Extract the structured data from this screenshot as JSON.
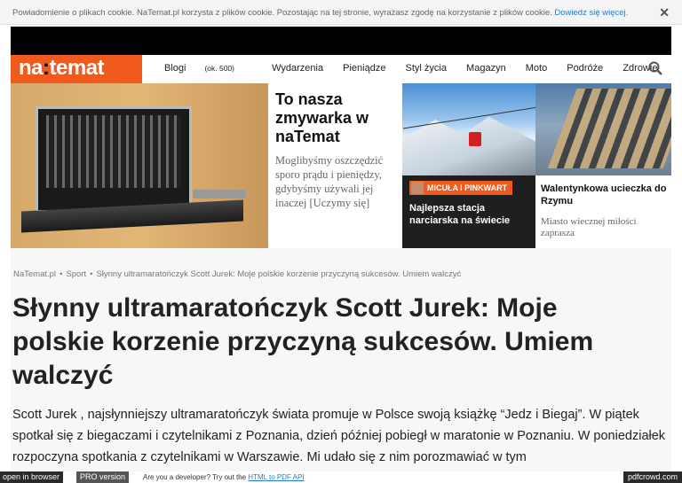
{
  "cookie": {
    "text": "Powiadomienie o plikach cookie. NaTemat.pl korzysta z plików cookie. Pozostając na tej stronie, wyrażasz zgodę na korzystanie z plików cookie. ",
    "link": "Dowiedz się więcej.",
    "close": "✕"
  },
  "nav": {
    "logo_a": "na",
    "logo_sep": ":",
    "logo_b": "temat",
    "items": [
      {
        "label": "Blogi",
        "extra": "(ok. 500)"
      },
      {
        "label": "Wydarzenia"
      },
      {
        "label": "Pieniądze"
      },
      {
        "label": "Styl życia"
      },
      {
        "label": "Magazyn"
      },
      {
        "label": "Moto"
      },
      {
        "label": "Podróże"
      },
      {
        "label": "Zdrowie"
      }
    ]
  },
  "hero": {
    "main_title": "To nasza zmywarka w naTemat",
    "main_text": "Moglibyśmy oszczędzić sporo prądu i pieniędzy, gdybyśmy używali jej inaczej [Uczymy się]",
    "ski_author": "MICUŁA I PINKWART",
    "ski_title": "Najlepsza stacja narciarska na świecie",
    "rome_title": "Walentynkowa ucieczka do Rzymu",
    "rome_text": "Miasto wiecznej miłości zaprasza"
  },
  "article": {
    "breadcrumbs": [
      "NaTemat.pl",
      "Sport",
      "Słynny ultramaratończyk Scott Jurek: Moje polskie korzenie przyczyną sukcesów. Umiem walczyć"
    ],
    "separator": "•",
    "title": "Słynny ultramaratończyk Scott Jurek: Moje polskie korzenie przyczyną sukcesów. Umiem walczyć",
    "lead": "Scott Jurek , najsłynniejszy ultramaratończyk świata promuje w Polsce swoją książkę “Jedz i Biegaj”. W piątek spotkał się z biegaczami i czytelnikami z Poznania, dzień później pobiegł w maratonie w Poznaniu. W poniedziałek rozpoczyna spotkania z czytelnikami w Warszawie. Mi udało się z nim porozmawiać w tym"
  },
  "pdfcrowd": {
    "open": "open in browser",
    "pro": "PRO version",
    "text": "Are you a developer? Try out the ",
    "link": "HTML to PDF API",
    "brand": "pdfcrowd.com"
  },
  "colors": {
    "brand": "#f05a1c"
  }
}
